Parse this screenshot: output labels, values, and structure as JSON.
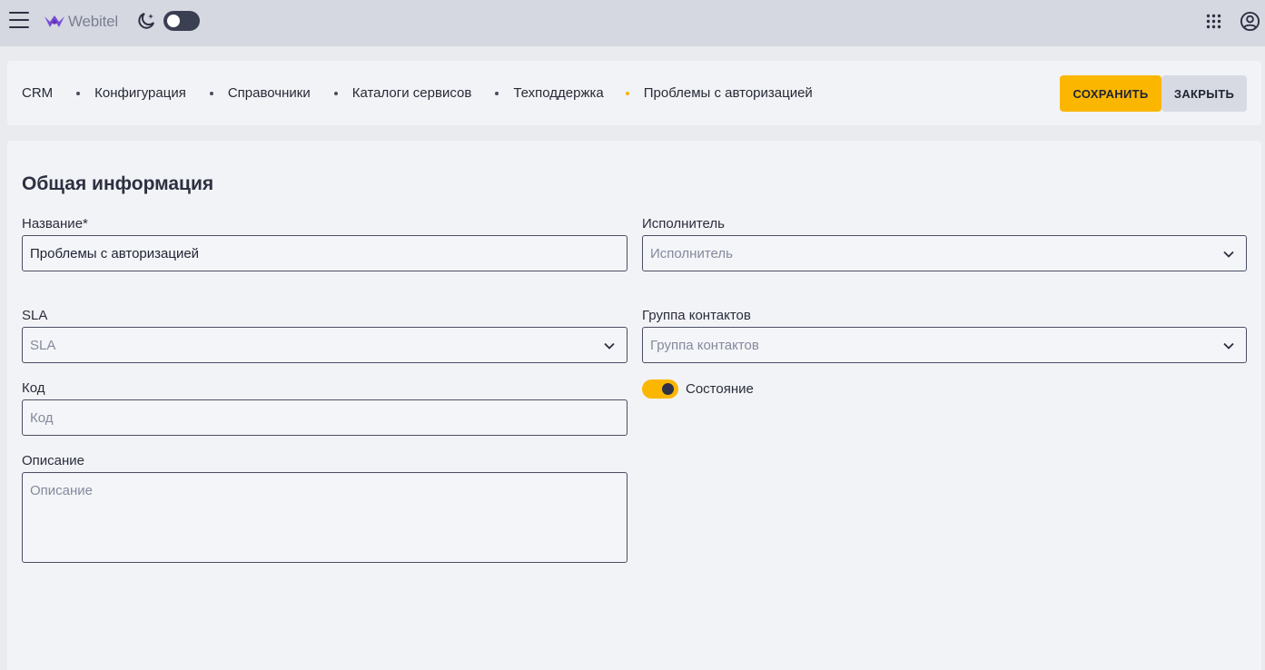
{
  "app": {
    "logo_text": "Webitel",
    "theme_mode": "light",
    "accent_color": "#fbb600"
  },
  "icons": {
    "menu": "hamburger-icon",
    "moon": "moon-icon",
    "apps": "grid-apps-icon",
    "user": "user-circle-icon",
    "chevron": "chevron-down-icon"
  },
  "breadcrumb": {
    "items": [
      "CRM",
      "Конфигурация",
      "Справочники",
      "Каталоги сервисов",
      "Техподдержка",
      "Проблемы с авторизацией"
    ]
  },
  "actions": {
    "save_label": "СОХРАНИТЬ",
    "close_label": "ЗАКРЫТЬ"
  },
  "form": {
    "title": "Общая информация",
    "name": {
      "label": "Название*",
      "value": "Проблемы с авторизацией"
    },
    "executor": {
      "label": "Исполнитель",
      "placeholder": "Исполнитель"
    },
    "sla": {
      "label": "SLA",
      "placeholder": "SLA"
    },
    "contact_group": {
      "label": "Группа контактов",
      "placeholder": "Группа контактов"
    },
    "code": {
      "label": "Код",
      "placeholder": "Код"
    },
    "description": {
      "label": "Описание",
      "placeholder": "Описание"
    },
    "state": {
      "label": "Состояние",
      "enabled": true
    }
  }
}
